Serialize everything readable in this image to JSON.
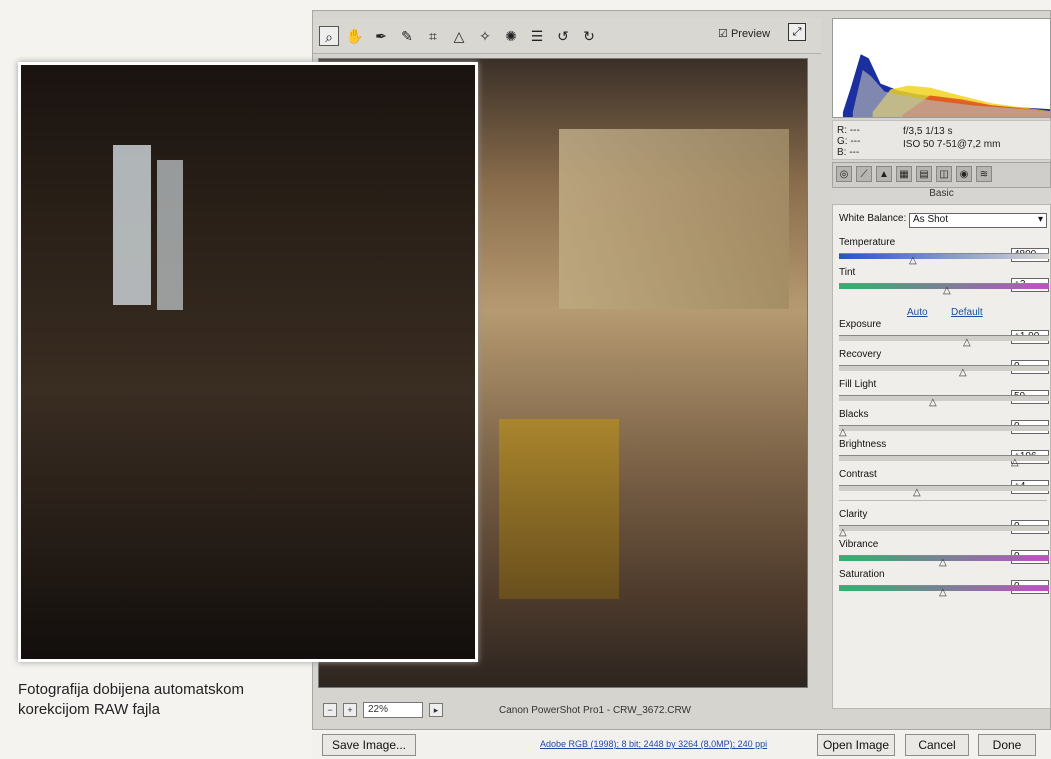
{
  "toolbar": {
    "preview_label": "Preview",
    "preview_checked": true,
    "icons": [
      "zoom-icon",
      "hand-icon",
      "white-balance-icon",
      "color-sampler-icon",
      "crop-icon",
      "straighten-icon",
      "retouch-icon",
      "red-eye-icon",
      "preferences-icon",
      "rotate-left-icon",
      "rotate-right-icon"
    ]
  },
  "caption": {
    "line1": "Fotografija dobijena automatskom",
    "line2": "korekcijom RAW fajla"
  },
  "image_bar": {
    "zoom_value": "22%",
    "filename": "Canon PowerShot Pro1 - CRW_3672.CRW"
  },
  "readout": {
    "r": "R: ---",
    "g": "G: ---",
    "b": "B: ---",
    "aperture": "f/3,5",
    "shutter": "1/13 s",
    "iso": "ISO 50",
    "lens": "7-51@7,2 mm"
  },
  "panel": {
    "title": "Basic",
    "white_balance_label": "White Balance:",
    "white_balance_value": "As Shot",
    "auto_link": "Auto",
    "default_link": "Default",
    "controls": [
      {
        "label": "Temperature",
        "value": "4800",
        "pos": 0.35
      },
      {
        "label": "Tint",
        "value": "+2",
        "pos": 0.52
      },
      {
        "label": "Exposure",
        "value": "+1,00",
        "pos": 0.62
      },
      {
        "label": "Recovery",
        "value": "0",
        "pos": 0.6
      },
      {
        "label": "Fill Light",
        "value": "50",
        "pos": 0.45
      },
      {
        "label": "Blacks",
        "value": "0",
        "pos": 0.0
      },
      {
        "label": "Brightness",
        "value": "+106",
        "pos": 0.86
      },
      {
        "label": "Contrast",
        "value": "+4",
        "pos": 0.37
      },
      {
        "label": "Clarity",
        "value": "0",
        "pos": 0.0
      },
      {
        "label": "Vibrance",
        "value": "0",
        "pos": 0.5
      },
      {
        "label": "Saturation",
        "value": "0",
        "pos": 0.5
      }
    ]
  },
  "footer": {
    "save_label": "Save Image...",
    "info_text": "Adobe RGB (1998); 8 bit; 2448 by 3264 (8,0MP); 240 ppi",
    "open_label": "Open Image",
    "cancel_label": "Cancel",
    "done_label": "Done"
  },
  "colors": {
    "accent_blue": "#2155c7",
    "window_bg": "#d6d4cf"
  }
}
